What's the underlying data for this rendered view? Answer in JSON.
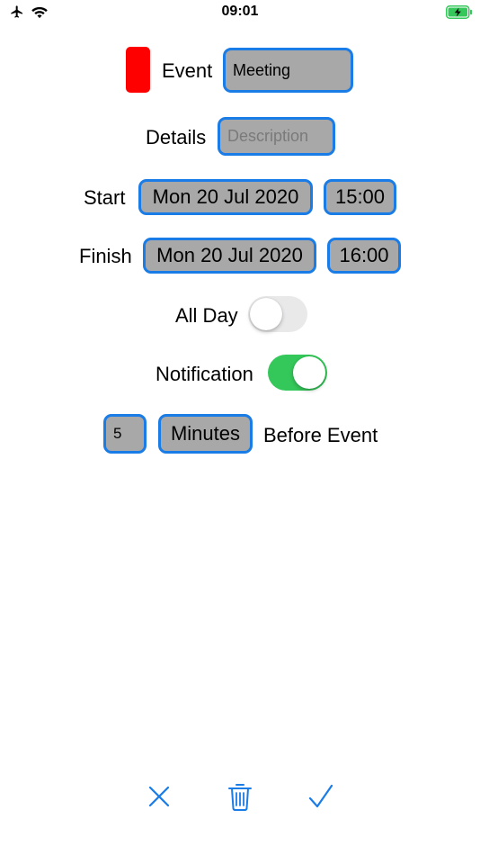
{
  "status_bar": {
    "time": "09:01"
  },
  "form": {
    "event_label": "Event",
    "event_value": "Meeting",
    "event_color": "#ff0000",
    "details_label": "Details",
    "details_placeholder": "Description",
    "start_label": "Start",
    "start_date": "Mon 20 Jul 2020",
    "start_time": "15:00",
    "finish_label": "Finish",
    "finish_date": "Mon 20 Jul 2020",
    "finish_time": "16:00",
    "all_day_label": "All Day",
    "all_day_on": false,
    "notification_label": "Notification",
    "notification_on": true,
    "reminder_amount": "5",
    "reminder_unit": "Minutes",
    "reminder_suffix": "Before Event"
  },
  "toolbar": {
    "cancel_icon": "close-icon",
    "delete_icon": "trash-icon",
    "confirm_icon": "checkmark-icon"
  },
  "colors": {
    "accent": "#1a7ce6",
    "field_bg": "#a8a8a8",
    "toggle_on": "#34c759",
    "toggle_off": "#e9e9ea",
    "battery": "#34c759"
  }
}
